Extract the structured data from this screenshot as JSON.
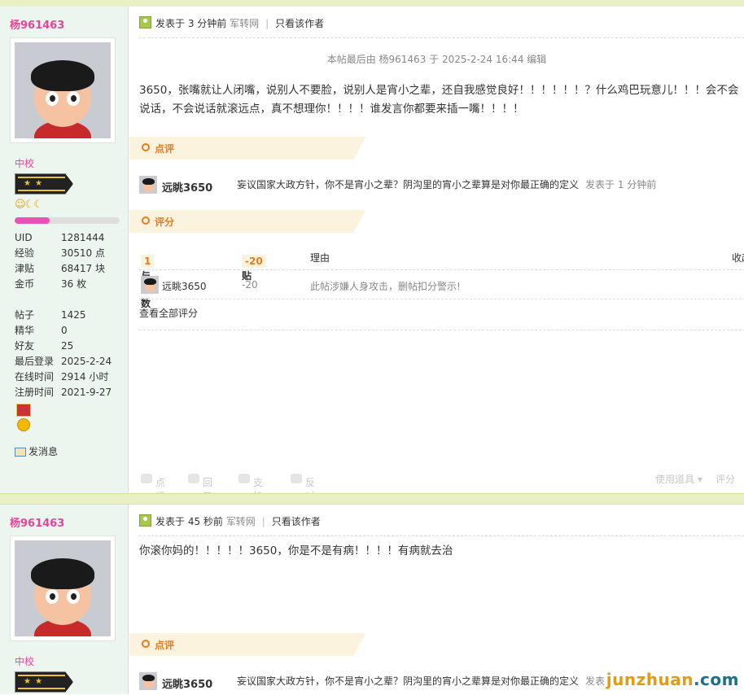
{
  "post1": {
    "author": "杨961463",
    "rank": "中校",
    "level_progress_pct": 33,
    "stats": [
      {
        "k": "UID",
        "v": "1281444"
      },
      {
        "k": "经验",
        "v": "30510 点"
      },
      {
        "k": "津贴",
        "v": "68417 块"
      },
      {
        "k": "金币",
        "v": "36 枚"
      },
      {
        "k": "帖子",
        "v": "1425"
      },
      {
        "k": "精华",
        "v": "0"
      },
      {
        "k": "好友",
        "v": "25"
      },
      {
        "k": "最后登录",
        "v": "2025-2-24"
      },
      {
        "k": "在线时间",
        "v": "2914 小时"
      },
      {
        "k": "注册时间",
        "v": "2021-9-27"
      }
    ],
    "send_msg": "发消息",
    "posted": "发表于 3 分钟前",
    "source": "军转网",
    "only_author": "只看该作者",
    "edited": "本帖最后由 杨961463 于 2025-2-24 16:44 编辑",
    "body": "3650，张嘴就让人闭嘴，说别人不要脸，说别人是宵小之辈，还自我感觉良好！！！！！！？什么鸡巴玩意儿！！！会不会说话，不会说话就滚远点，真不想理你！！！！谁发言你都要来插一嘴！！！！",
    "review_label": "点评",
    "comment": {
      "name": "远眺3650",
      "text": "妄议国家大政方针，你不是宵小之辈？阴沟里的宵小之辈算是对你最正确的定义",
      "time": "发表于 1 分钟前"
    },
    "rating_label": "评分",
    "rating": {
      "participants_label": "参与人数",
      "participants": "1",
      "allowance_label": "津贴",
      "allowance": "-20",
      "reason_label": "理由",
      "collapse_label": "收起",
      "row": {
        "name": "远眺3650",
        "value": "-20",
        "reason": "此帖涉嫌人身攻击，删帖扣分警示!"
      },
      "view_all": "查看全部评分"
    },
    "actions": [
      "点评",
      "回复",
      "支持",
      "反对"
    ],
    "tools": "使用道具 ▾",
    "rate_btn": "评分"
  },
  "post2": {
    "author": "杨961463",
    "rank": "中校",
    "posted": "发表于 45 秒前",
    "source": "军转网",
    "only_author": "只看该作者",
    "body": "你滚你妈的！！！！！3650，你是不是有病！！！！有病就去治",
    "review_label": "点评",
    "comment": {
      "name": "远眺3650",
      "text": "妄议国家大政方针，你不是宵小之辈？阴沟里的宵小之辈算是对你最正确的定义",
      "time": "发表"
    }
  },
  "watermark": {
    "u": "junzhuan",
    "rest": ".com"
  }
}
